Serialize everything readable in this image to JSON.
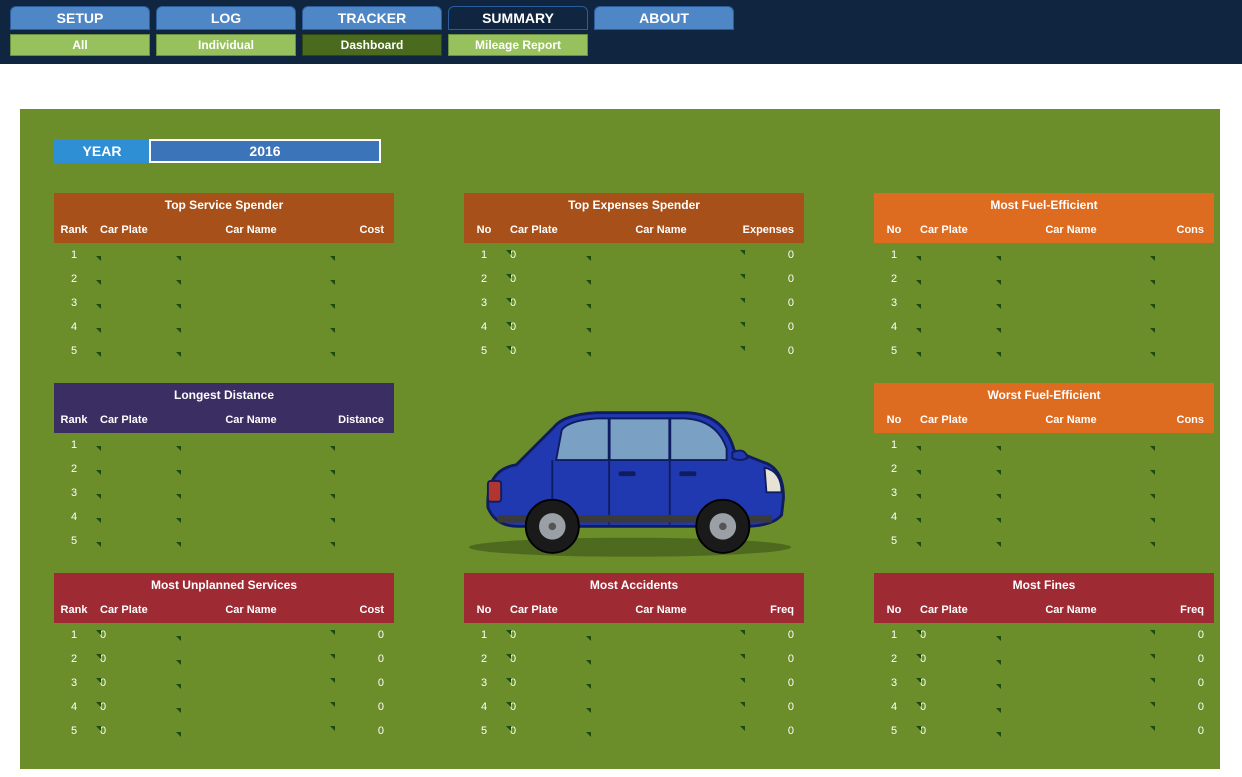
{
  "tabs": {
    "setup": "SETUP",
    "log": "LOG",
    "tracker": "TRACKER",
    "summary": "SUMMARY",
    "about": "ABOUT"
  },
  "subtabs": {
    "all": "All",
    "individual": "Individual",
    "dashboard": "Dashboard",
    "mileage": "Mileage Report"
  },
  "year": {
    "label": "YEAR",
    "value": "2016"
  },
  "panels": {
    "p0": {
      "title": "Top Service Spender",
      "h1": "Rank",
      "h2": "Car Plate",
      "h3": "Car Name",
      "h4": "Cost",
      "r1": {
        "a": "1",
        "b": "",
        "d": ""
      },
      "r2": {
        "a": "2",
        "b": "",
        "d": ""
      },
      "r3": {
        "a": "3",
        "b": "",
        "d": ""
      },
      "r4": {
        "a": "4",
        "b": "",
        "d": ""
      },
      "r5": {
        "a": "5",
        "b": "",
        "d": ""
      }
    },
    "p1": {
      "title": "Top Expenses Spender",
      "h1": "No",
      "h2": "Car Plate",
      "h3": "Car Name",
      "h4": "Expenses",
      "r1": {
        "a": "1",
        "b": "0",
        "d": "0"
      },
      "r2": {
        "a": "2",
        "b": "0",
        "d": "0"
      },
      "r3": {
        "a": "3",
        "b": "0",
        "d": "0"
      },
      "r4": {
        "a": "4",
        "b": "0",
        "d": "0"
      },
      "r5": {
        "a": "5",
        "b": "0",
        "d": "0"
      }
    },
    "p2": {
      "title": "Most Fuel-Efficient",
      "h1": "No",
      "h2": "Car Plate",
      "h3": "Car Name",
      "h4": "Cons",
      "r1": {
        "a": "1",
        "b": "",
        "d": ""
      },
      "r2": {
        "a": "2",
        "b": "",
        "d": ""
      },
      "r3": {
        "a": "3",
        "b": "",
        "d": ""
      },
      "r4": {
        "a": "4",
        "b": "",
        "d": ""
      },
      "r5": {
        "a": "5",
        "b": "",
        "d": ""
      }
    },
    "p3": {
      "title": "Longest Distance",
      "h1": "Rank",
      "h2": "Car Plate",
      "h3": "Car Name",
      "h4": "Distance",
      "r1": {
        "a": "1",
        "b": "",
        "d": ""
      },
      "r2": {
        "a": "2",
        "b": "",
        "d": ""
      },
      "r3": {
        "a": "3",
        "b": "",
        "d": ""
      },
      "r4": {
        "a": "4",
        "b": "",
        "d": ""
      },
      "r5": {
        "a": "5",
        "b": "",
        "d": ""
      }
    },
    "p4": {
      "title": "Worst Fuel-Efficient",
      "h1": "No",
      "h2": "Car Plate",
      "h3": "Car Name",
      "h4": "Cons",
      "r1": {
        "a": "1",
        "b": "",
        "d": ""
      },
      "r2": {
        "a": "2",
        "b": "",
        "d": ""
      },
      "r3": {
        "a": "3",
        "b": "",
        "d": ""
      },
      "r4": {
        "a": "4",
        "b": "",
        "d": ""
      },
      "r5": {
        "a": "5",
        "b": "",
        "d": ""
      }
    },
    "p5": {
      "title": "Most Unplanned Services",
      "h1": "Rank",
      "h2": "Car Plate",
      "h3": "Car Name",
      "h4": "Cost",
      "r1": {
        "a": "1",
        "b": "0",
        "d": "0"
      },
      "r2": {
        "a": "2",
        "b": "0",
        "d": "0"
      },
      "r3": {
        "a": "3",
        "b": "0",
        "d": "0"
      },
      "r4": {
        "a": "4",
        "b": "0",
        "d": "0"
      },
      "r5": {
        "a": "5",
        "b": "0",
        "d": "0"
      }
    },
    "p6": {
      "title": "Most Accidents",
      "h1": "No",
      "h2": "Car Plate",
      "h3": "Car Name",
      "h4": "Freq",
      "r1": {
        "a": "1",
        "b": "0",
        "d": "0"
      },
      "r2": {
        "a": "2",
        "b": "0",
        "d": "0"
      },
      "r3": {
        "a": "3",
        "b": "0",
        "d": "0"
      },
      "r4": {
        "a": "4",
        "b": "0",
        "d": "0"
      },
      "r5": {
        "a": "5",
        "b": "0",
        "d": "0"
      }
    },
    "p7": {
      "title": "Most Fines",
      "h1": "No",
      "h2": "Car Plate",
      "h3": "Car Name",
      "h4": "Freq",
      "r1": {
        "a": "1",
        "b": "0",
        "d": "0"
      },
      "r2": {
        "a": "2",
        "b": "0",
        "d": "0"
      },
      "r3": {
        "a": "3",
        "b": "0",
        "d": "0"
      },
      "r4": {
        "a": "4",
        "b": "0",
        "d": "0"
      },
      "r5": {
        "a": "5",
        "b": "0",
        "d": "0"
      }
    }
  }
}
